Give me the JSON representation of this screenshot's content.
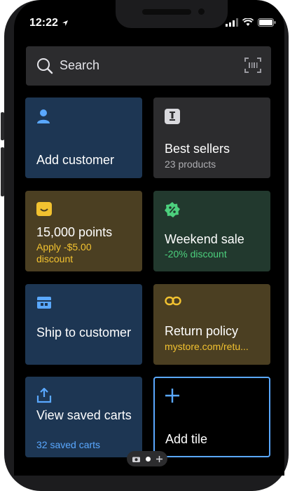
{
  "status_bar": {
    "time": "12:22"
  },
  "search": {
    "label": "Search"
  },
  "tiles": {
    "add_customer": {
      "title": "Add customer"
    },
    "best_sellers": {
      "title": "Best sellers",
      "subtitle": "23 products"
    },
    "points": {
      "title": "15,000 points",
      "subtitle": "Apply -$5.00 discount"
    },
    "weekend_sale": {
      "title": "Weekend sale",
      "subtitle": "-20% discount"
    },
    "ship": {
      "title": "Ship to customer"
    },
    "return_policy": {
      "title": "Return policy",
      "subtitle": "mystore.com/retu..."
    },
    "saved_carts": {
      "title": "View saved carts",
      "subtitle": "32 saved carts"
    },
    "add_tile": {
      "title": "Add tile"
    }
  },
  "colors": {
    "blue_tile": "#1d3653",
    "gray_tile": "#2c2c2e",
    "yellow_tile": "#4b3f22",
    "green_tile": "#22392e",
    "blue_text": "#5aa8ff",
    "yellow_text": "#f2c230",
    "green_text": "#4cd07d"
  },
  "icons": {
    "add_customer": "person-icon",
    "best_sellers": "trophy-icon",
    "points": "smile-badge-icon",
    "weekend_sale": "percent-badge-icon",
    "ship": "shipping-box-icon",
    "return_policy": "link-icon",
    "saved_carts": "share-upload-icon",
    "add_tile": "plus-icon"
  }
}
